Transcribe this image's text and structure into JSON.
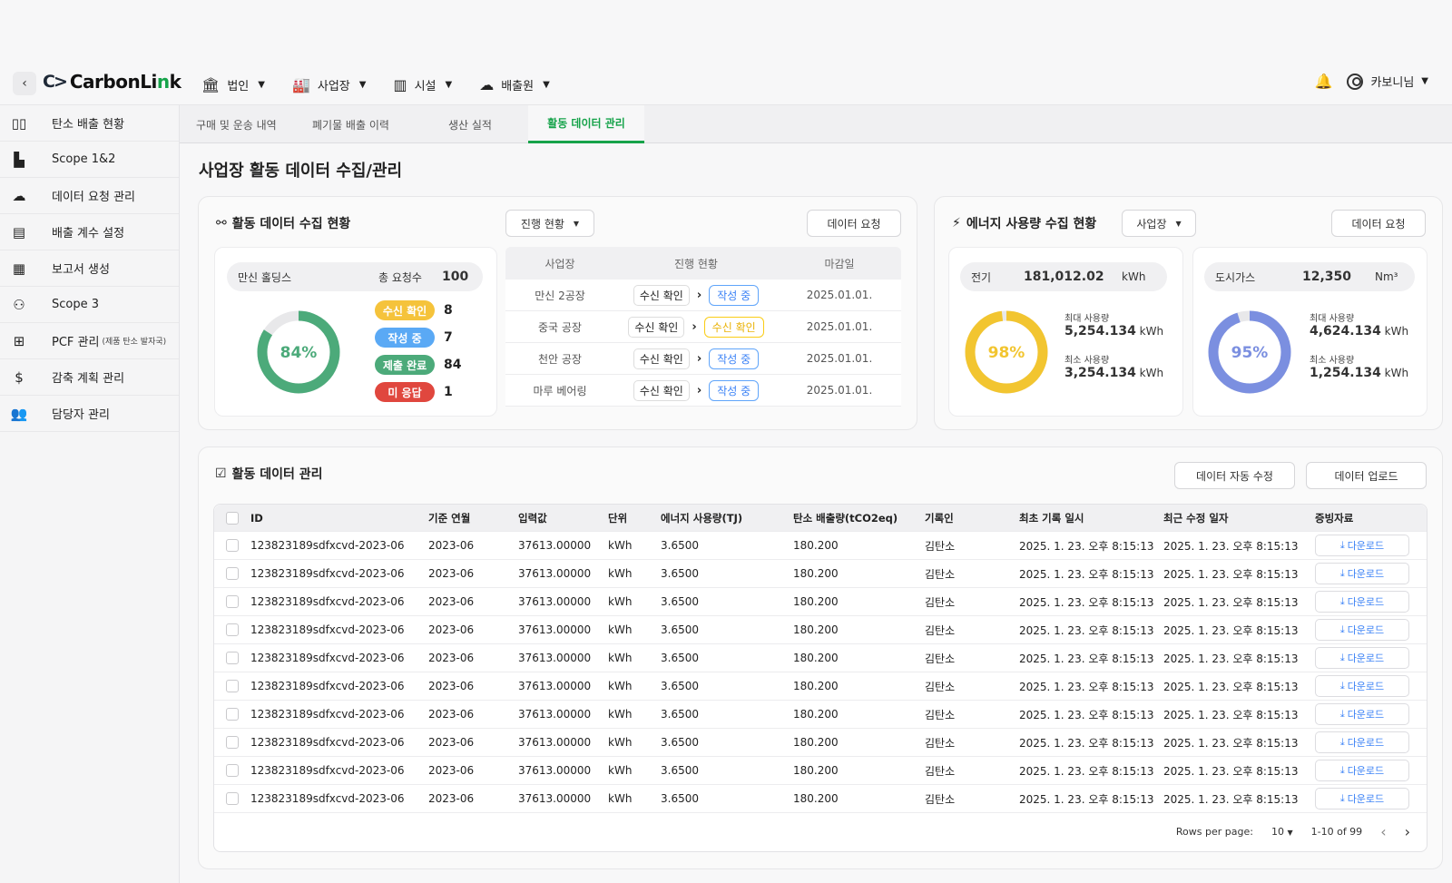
{
  "header": {
    "logo_mark": "C>",
    "logo_prefix": "CarbonLi",
    "logo_accent": "n",
    "logo_suffix": "k",
    "nav": [
      {
        "label": "법인"
      },
      {
        "label": "사업장"
      },
      {
        "label": "시설"
      },
      {
        "label": "배출원"
      }
    ],
    "user_name": "카보니님"
  },
  "sidebar": {
    "items": [
      {
        "label": "탄소 배출 현황"
      },
      {
        "label": "Scope 1&2"
      },
      {
        "label": "데이터 요청 관리"
      },
      {
        "label": "배출 계수 설정"
      },
      {
        "label": "보고서 생성"
      },
      {
        "label": "Scope 3"
      },
      {
        "label": "PCF 관리",
        "note": "(제품 탄소 발자국)"
      },
      {
        "label": "감축 계획 관리"
      },
      {
        "label": "담당자 관리"
      }
    ]
  },
  "tabs": [
    {
      "label": "구매 및 운송 내역"
    },
    {
      "label": "폐기물 배출 이력"
    },
    {
      "label": "생산 실적"
    },
    {
      "label": "활동 데이터 관리"
    }
  ],
  "page_title": "사업장 활동 데이터 수집/관리",
  "collection": {
    "title": "활동 데이터 수집 현황",
    "filter": "진행 현황",
    "request_button": "데이터 요청",
    "company": "만신 홀딩스",
    "total_label": "총 요청수",
    "total_value": "100",
    "percent": 84,
    "percent_label": "84%",
    "statuses": [
      {
        "label": "수신 확인",
        "count": "8",
        "color": "#f5c33b"
      },
      {
        "label": "작성 중",
        "count": "7",
        "color": "#5aa9f5"
      },
      {
        "label": "제출 완료",
        "count": "84",
        "color": "#4caa7a"
      },
      {
        "label": "미 응답",
        "count": "1",
        "color": "#e0473e"
      }
    ],
    "table": {
      "headers": [
        "사업장",
        "진행 현황",
        "마감일"
      ],
      "rows": [
        {
          "site": "만신 2공장",
          "from": "수신 확인",
          "to": "작성 중",
          "to_style": "blue",
          "due": "2025.01.01."
        },
        {
          "site": "중국 공장",
          "from": "수신 확인",
          "to": "수신 확인",
          "to_style": "yellow",
          "due": "2025.01.01."
        },
        {
          "site": "천안 공장",
          "from": "수신 확인",
          "to": "작성 중",
          "to_style": "blue",
          "due": "2025.01.01."
        },
        {
          "site": "마루 베어링",
          "from": "수신 확인",
          "to": "작성 중",
          "to_style": "blue",
          "due": "2025.01.01."
        }
      ]
    }
  },
  "energy": {
    "title": "에너지 사용량 수집 현황",
    "filter": "사업장",
    "request_button": "데이터 요청",
    "cards": [
      {
        "name": "전기",
        "total": "181,012.02",
        "unit": "kWh",
        "percent": 98,
        "percent_label": "98%",
        "color": "#f2c530",
        "max_label": "최대 사용량",
        "max_value": "5,254.134",
        "min_label": "최소 사용량",
        "min_value": "3,254.134",
        "value_unit": "kWh"
      },
      {
        "name": "도시가스",
        "total": "12,350",
        "unit": "Nm³",
        "percent": 95,
        "percent_label": "95%",
        "color": "#7b8fe0",
        "max_label": "최대 사용량",
        "max_value": "4,624.134",
        "min_label": "최소 사용량",
        "min_value": "1,254.134",
        "value_unit": "kWh"
      }
    ]
  },
  "management": {
    "title": "활동 데이터 관리",
    "auto_edit_button": "데이터 자동 수정",
    "upload_button": "데이터 업로드",
    "columns": [
      "ID",
      "기준 연월",
      "입력값",
      "단위",
      "에너지 사용량(TJ)",
      "탄소 배출량(tCO2eq)",
      "기록인",
      "최초 기록 일시",
      "최근 수정 일자",
      "증빙자료"
    ],
    "download_label": "다운로드",
    "rows": [
      [
        "123823189sdfxcvd-2023-06",
        "2023-06",
        "37613.00000",
        "kWh",
        "3.6500",
        "180.200",
        "김탄소",
        "2025. 1. 23. 오후 8:15:13",
        "2025. 1. 23. 오후 8:15:13"
      ],
      [
        "123823189sdfxcvd-2023-06",
        "2023-06",
        "37613.00000",
        "kWh",
        "3.6500",
        "180.200",
        "김탄소",
        "2025. 1. 23. 오후 8:15:13",
        "2025. 1. 23. 오후 8:15:13"
      ],
      [
        "123823189sdfxcvd-2023-06",
        "2023-06",
        "37613.00000",
        "kWh",
        "3.6500",
        "180.200",
        "김탄소",
        "2025. 1. 23. 오후 8:15:13",
        "2025. 1. 23. 오후 8:15:13"
      ],
      [
        "123823189sdfxcvd-2023-06",
        "2023-06",
        "37613.00000",
        "kWh",
        "3.6500",
        "180.200",
        "김탄소",
        "2025. 1. 23. 오후 8:15:13",
        "2025. 1. 23. 오후 8:15:13"
      ],
      [
        "123823189sdfxcvd-2023-06",
        "2023-06",
        "37613.00000",
        "kWh",
        "3.6500",
        "180.200",
        "김탄소",
        "2025. 1. 23. 오후 8:15:13",
        "2025. 1. 23. 오후 8:15:13"
      ],
      [
        "123823189sdfxcvd-2023-06",
        "2023-06",
        "37613.00000",
        "kWh",
        "3.6500",
        "180.200",
        "김탄소",
        "2025. 1. 23. 오후 8:15:13",
        "2025. 1. 23. 오후 8:15:13"
      ],
      [
        "123823189sdfxcvd-2023-06",
        "2023-06",
        "37613.00000",
        "kWh",
        "3.6500",
        "180.200",
        "김탄소",
        "2025. 1. 23. 오후 8:15:13",
        "2025. 1. 23. 오후 8:15:13"
      ],
      [
        "123823189sdfxcvd-2023-06",
        "2023-06",
        "37613.00000",
        "kWh",
        "3.6500",
        "180.200",
        "김탄소",
        "2025. 1. 23. 오후 8:15:13",
        "2025. 1. 23. 오후 8:15:13"
      ],
      [
        "123823189sdfxcvd-2023-06",
        "2023-06",
        "37613.00000",
        "kWh",
        "3.6500",
        "180.200",
        "김탄소",
        "2025. 1. 23. 오후 8:15:13",
        "2025. 1. 23. 오후 8:15:13"
      ],
      [
        "123823189sdfxcvd-2023-06",
        "2023-06",
        "37613.00000",
        "kWh",
        "3.6500",
        "180.200",
        "김탄소",
        "2025. 1. 23. 오후 8:15:13",
        "2025. 1. 23. 오후 8:15:13"
      ]
    ],
    "pagination": {
      "rows_per_page_label": "Rows per page:",
      "rows_per_page": "10",
      "range": "1-10 of 99"
    }
  },
  "colors": {
    "accent": "#16a34a",
    "donut_green": "#4caa7a"
  }
}
